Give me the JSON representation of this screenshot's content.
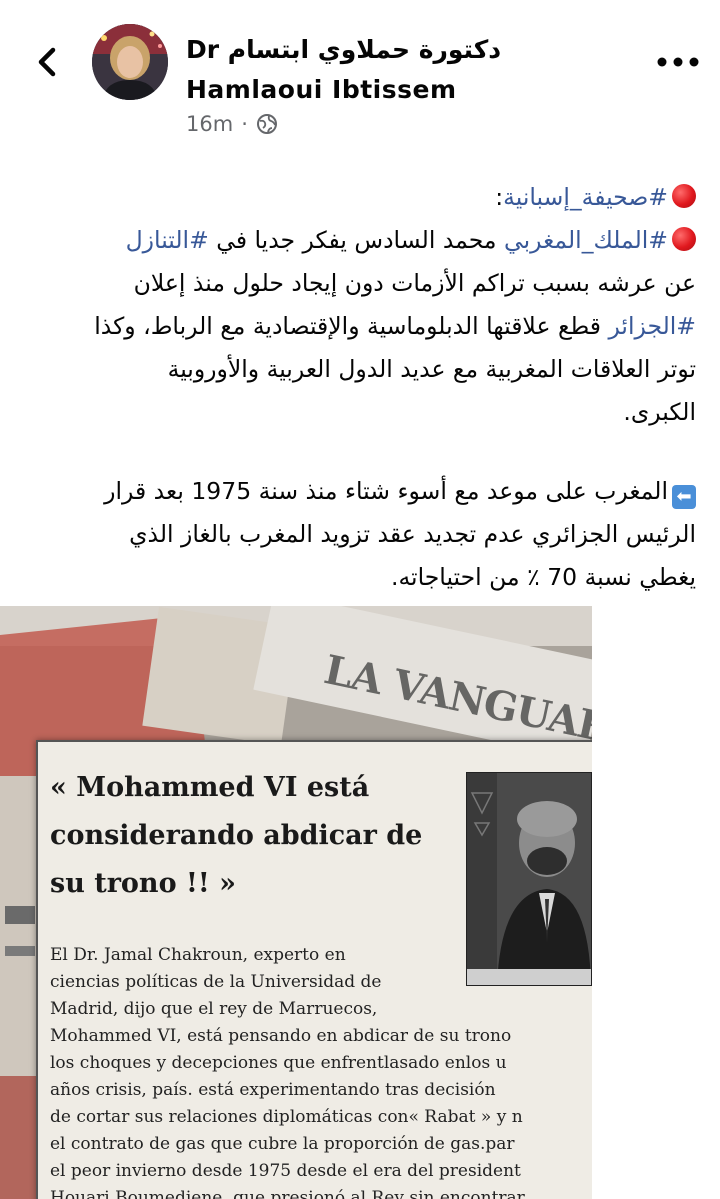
{
  "header": {
    "back_icon": "chevron-left-icon",
    "author_line1": "Dr  دكتورة حملاوي ابتسام",
    "author_line2": "Hamlaoui  Ibtissem",
    "time": "16m",
    "separator": "·",
    "audience_icon": "globe-icon",
    "more_icon": "more-horizontal-icon"
  },
  "post": {
    "line1_hashtag": "#صحيفة_إسبانية",
    "line1_rest": ":",
    "line2_hashtag1": "#الملك_المغربي",
    "line2_text": " محمد السادس يفكر جديا في ",
    "line2_hashtag2": "#التنازل",
    "line3": "عن عرشه بسبب تراكم الأزمات دون إيجاد حلول منذ إعلان",
    "line4_hashtag": "#الجزائر",
    "line4_text": " قطع علاقتها الدبلوماسية والإقتصادية مع الرباط، وكذا",
    "line5": "توتر العلاقات المغربية مع عديد الدول العربية والأوروبية",
    "line6": "الكبرى.",
    "para2_line1": "المغرب على موعد مع أسوء شتاء منذ سنة 1975 بعد قرار",
    "para2_line2": "الرئيس الجزائري عدم تجديد عقد تزويد المغرب بالغاز الذي",
    "para2_line3": "يغطي نسبة 70 ٪ من احتياجاته."
  },
  "image": {
    "newspaper_masthead": "LA VANGUARDIA",
    "clipping_title_l1": "« Mohammed VI está",
    "clipping_title_l2": "considerando abdicar de",
    "clipping_title_l3": "su trono !! »",
    "body": [
      "El Dr. Jamal Chakroun, experto en",
      "ciencias políticas de la Universidad de",
      "Madrid, dijo que el rey de Marruecos,",
      "Mohammed VI, está pensando en abdicar de su trono",
      "los choques y decepciones que enfrentlasado enlos u",
      "años crisis, país.  está experimentando tras  decisión",
      "de cortar sus relaciones diplomáticas con« Rabat » y n",
      "el contrato de gas que cubre la proporción de gas.par",
      "el peor invierno desde 1975 desde el era del president",
      "Houari Boumediene, que presionó al Rey sin encontrar"
    ]
  }
}
